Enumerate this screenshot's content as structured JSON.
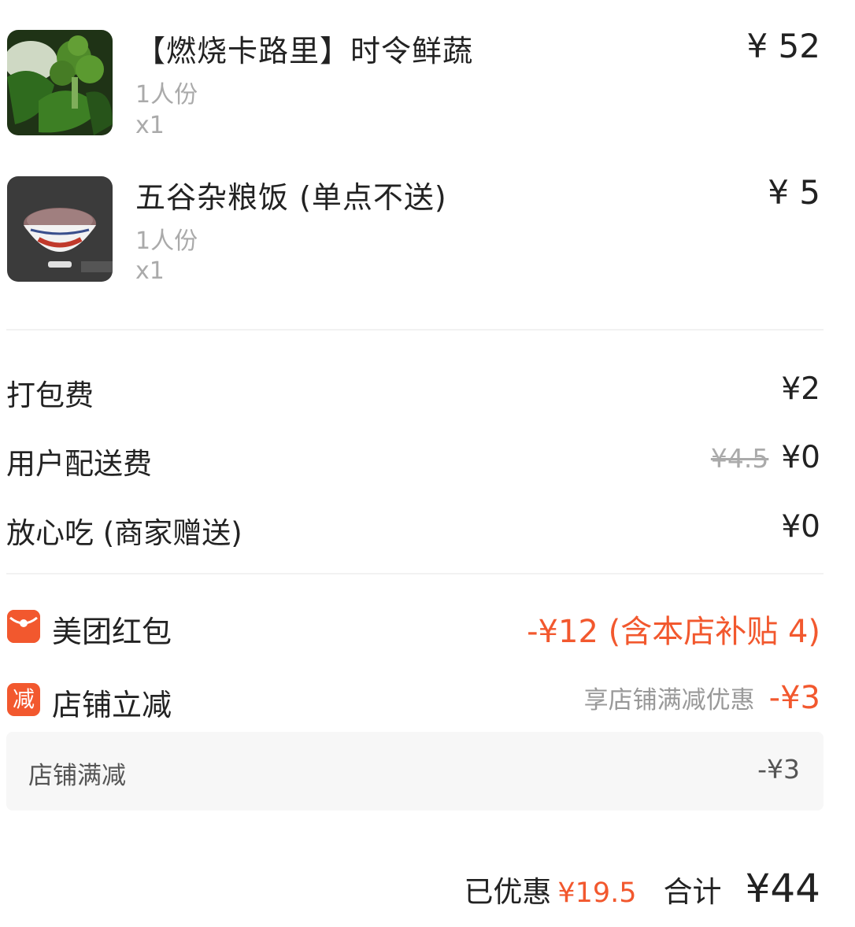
{
  "items": [
    {
      "name": "【燃烧卡路里】时令鲜蔬",
      "spec": "1人份",
      "qty": "x1",
      "price": "¥ 52",
      "image": "broccoli-greens-image"
    },
    {
      "name": "五谷杂粮饭 (单点不送)",
      "spec": "1人份",
      "qty": "x1",
      "price": "¥ 5",
      "image": "rice-bowl-image"
    }
  ],
  "fees": [
    {
      "label": "打包费",
      "value": "¥2"
    },
    {
      "label": "用户配送费",
      "original": "¥4.5",
      "value": "¥0"
    },
    {
      "label": "放心吃 (商家赠送)",
      "value": "¥0"
    }
  ],
  "promos": {
    "red_packet": {
      "icon": "red-envelope-icon",
      "label": "美团红包",
      "value": "-¥12 (含本店补贴 4)"
    },
    "store_discount": {
      "icon_text": "减",
      "label": "店铺立减",
      "note": "享店铺满减优惠",
      "value": "-¥3"
    },
    "detail": {
      "label": "店铺满减",
      "value": "-¥3"
    }
  },
  "summary": {
    "saved_label": "已优惠",
    "saved_value": "¥19.5",
    "total_label": "合计",
    "total_value": "¥44"
  },
  "colors": {
    "accent": "#f2582e",
    "muted": "#aaaaaa"
  }
}
